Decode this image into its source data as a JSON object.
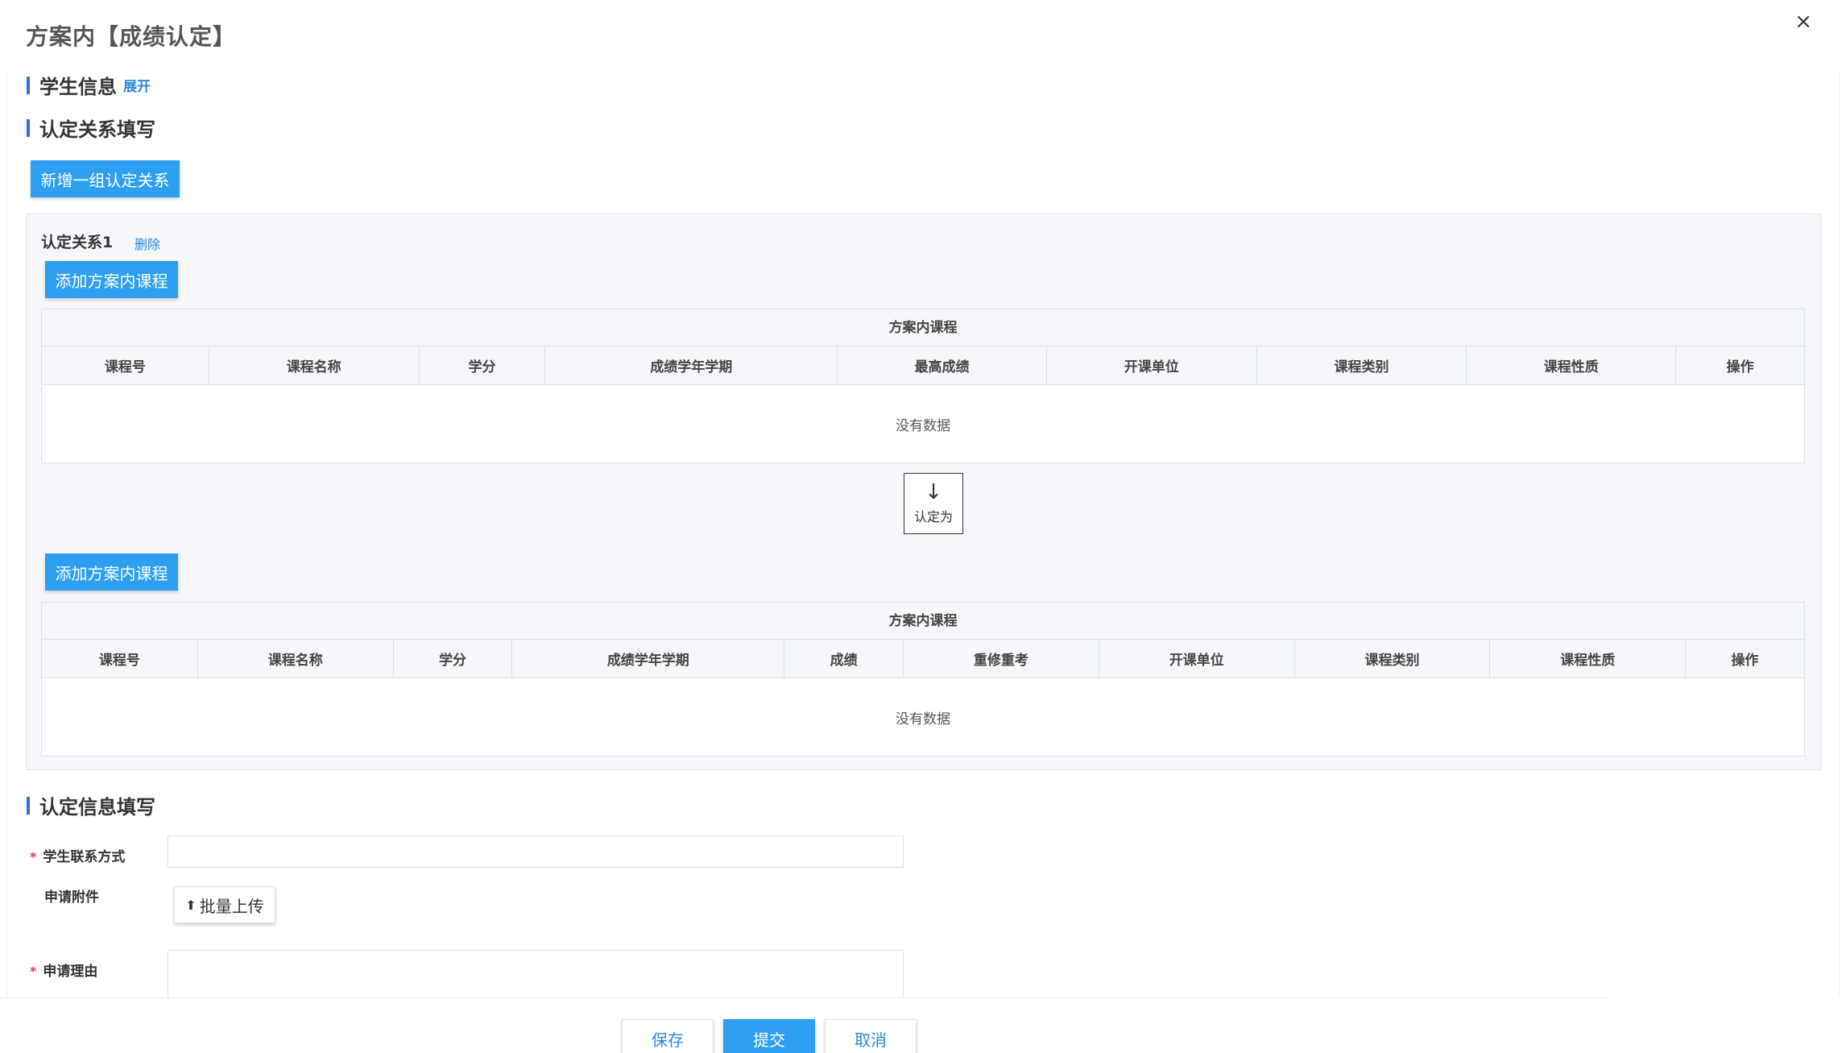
{
  "dialog": {
    "title": "方案内【成绩认定】",
    "close_glyph": "×"
  },
  "student_info": {
    "title": "学生信息",
    "toggle": "展开"
  },
  "relation_section": {
    "title": "认定关系填写",
    "add_group_button": "新增一组认定关系"
  },
  "group": {
    "label": "认定关系1",
    "delete": "删除",
    "add_course_top": "添加方案内课程",
    "add_course_bottom": "添加方案内课程",
    "recognize_as": "认定为",
    "arrow_glyph": "↓"
  },
  "table_top": {
    "caption": "方案内课程",
    "columns": [
      "课程号",
      "课程名称",
      "学分",
      "成绩学年学期",
      "最高成绩",
      "开课单位",
      "课程类别",
      "课程性质",
      "操作"
    ],
    "empty_text": "没有数据"
  },
  "table_bottom": {
    "caption": "方案内课程",
    "columns": [
      "课程号",
      "课程名称",
      "学分",
      "成绩学年学期",
      "成绩",
      "重修重考",
      "开课单位",
      "课程类别",
      "课程性质",
      "操作"
    ],
    "empty_text": "没有数据"
  },
  "info_section": {
    "title": "认定信息填写",
    "contact_label": "学生联系方式",
    "attachment_label": "申请附件",
    "upload_button": "批量上传",
    "upload_glyph": "⬆",
    "reason_label": "申请理由",
    "required_mark": "*",
    "contact_value": "",
    "reason_value": ""
  },
  "footer": {
    "save": "保存",
    "submit": "提交",
    "cancel": "取消"
  },
  "colors": {
    "primary": "#2e9ff0",
    "link": "#2a87d8",
    "section_bar": "#3471c5",
    "required": "#e4393c"
  }
}
